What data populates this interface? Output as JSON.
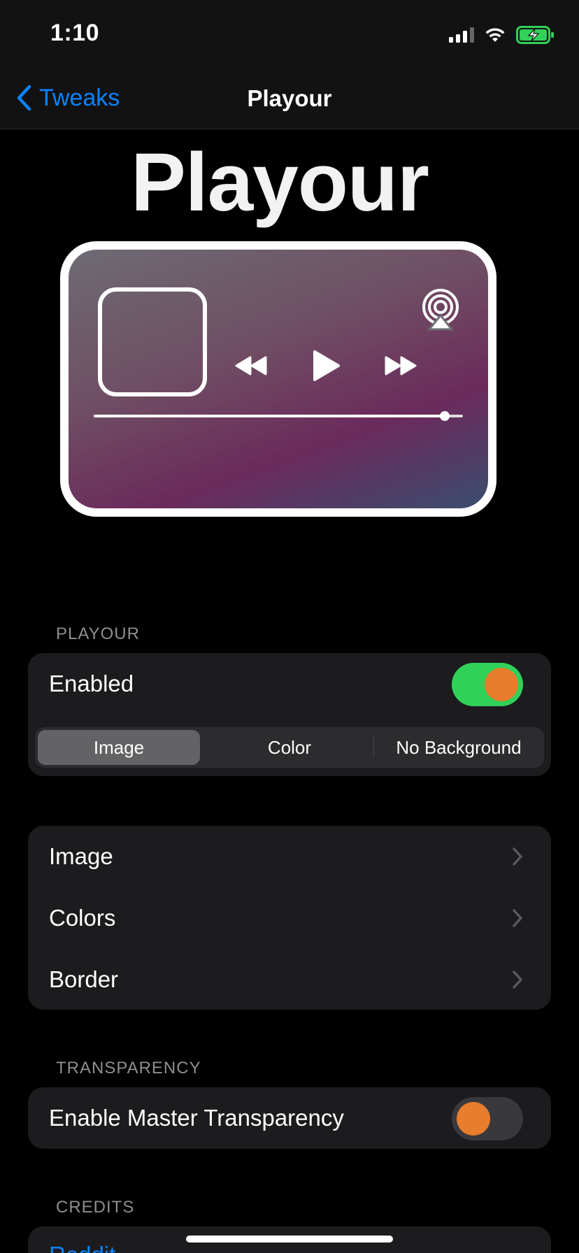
{
  "status_bar": {
    "time": "1:10"
  },
  "nav": {
    "back_label": "Tweaks",
    "title": "Playour"
  },
  "banner": {
    "title": "Playour",
    "progress": 0.95
  },
  "sections": {
    "playour": {
      "header": "PLAYOUR",
      "enabled_label": "Enabled",
      "enabled": true,
      "segments": [
        "Image",
        "Color",
        "No Background"
      ],
      "selected_segment": "Image"
    },
    "options": {
      "items": [
        "Image",
        "Colors",
        "Border"
      ]
    },
    "transparency": {
      "header": "TRANSPARENCY",
      "master_label": "Enable Master Transparency",
      "master_enabled": false
    },
    "credits": {
      "header": "CREDITS",
      "first_item": "Reddit"
    }
  },
  "colors": {
    "accent": "#0a84ff",
    "toggle_on": "#30d158",
    "toggle_knob": "#e87d2d"
  }
}
